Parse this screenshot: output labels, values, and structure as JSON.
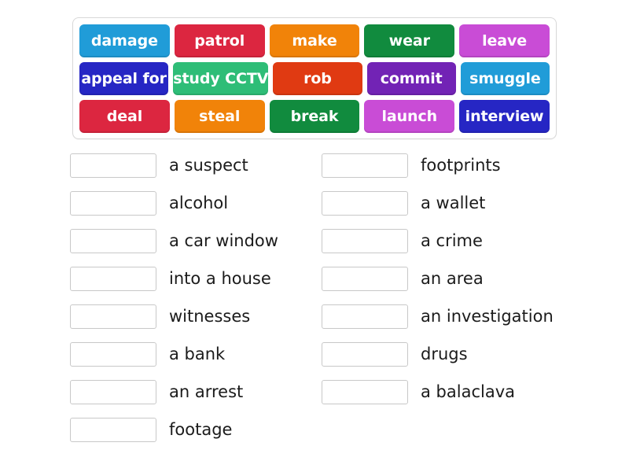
{
  "activity": {
    "type": "match-up",
    "tile_bank": {
      "rows": [
        [
          {
            "label": "damage",
            "color": "#209cd8"
          },
          {
            "label": "patrol",
            "color": "#dc2640"
          },
          {
            "label": "make",
            "color": "#f18309"
          },
          {
            "label": "wear",
            "color": "#118b3e"
          },
          {
            "label": "leave",
            "color": "#c94cd6"
          }
        ],
        [
          {
            "label": "appeal for",
            "color": "#2626c4"
          },
          {
            "label": "study CCTV",
            "color": "#2ebd77"
          },
          {
            "label": "rob",
            "color": "#e03a12"
          },
          {
            "label": "commit",
            "color": "#7223b5"
          },
          {
            "label": "smuggle",
            "color": "#209cd8"
          }
        ],
        [
          {
            "label": "deal",
            "color": "#dc2640"
          },
          {
            "label": "steal",
            "color": "#f18309"
          },
          {
            "label": "break",
            "color": "#118b3e"
          },
          {
            "label": "launch",
            "color": "#c94cd6"
          },
          {
            "label": "interview",
            "color": "#2626c4"
          }
        ]
      ]
    },
    "columns": {
      "left": [
        {
          "drop_value": "",
          "label": "a suspect"
        },
        {
          "drop_value": "",
          "label": "alcohol"
        },
        {
          "drop_value": "",
          "label": "a car window"
        },
        {
          "drop_value": "",
          "label": "into a house"
        },
        {
          "drop_value": "",
          "label": "witnesses"
        },
        {
          "drop_value": "",
          "label": "a bank"
        },
        {
          "drop_value": "",
          "label": "an arrest"
        },
        {
          "drop_value": "",
          "label": "footage"
        }
      ],
      "right": [
        {
          "drop_value": "",
          "label": "footprints"
        },
        {
          "drop_value": "",
          "label": "a wallet"
        },
        {
          "drop_value": "",
          "label": "a crime"
        },
        {
          "drop_value": "",
          "label": "an area"
        },
        {
          "drop_value": "",
          "label": "an investigation"
        },
        {
          "drop_value": "",
          "label": "drugs"
        },
        {
          "drop_value": "",
          "label": "a balaclava"
        }
      ]
    }
  }
}
